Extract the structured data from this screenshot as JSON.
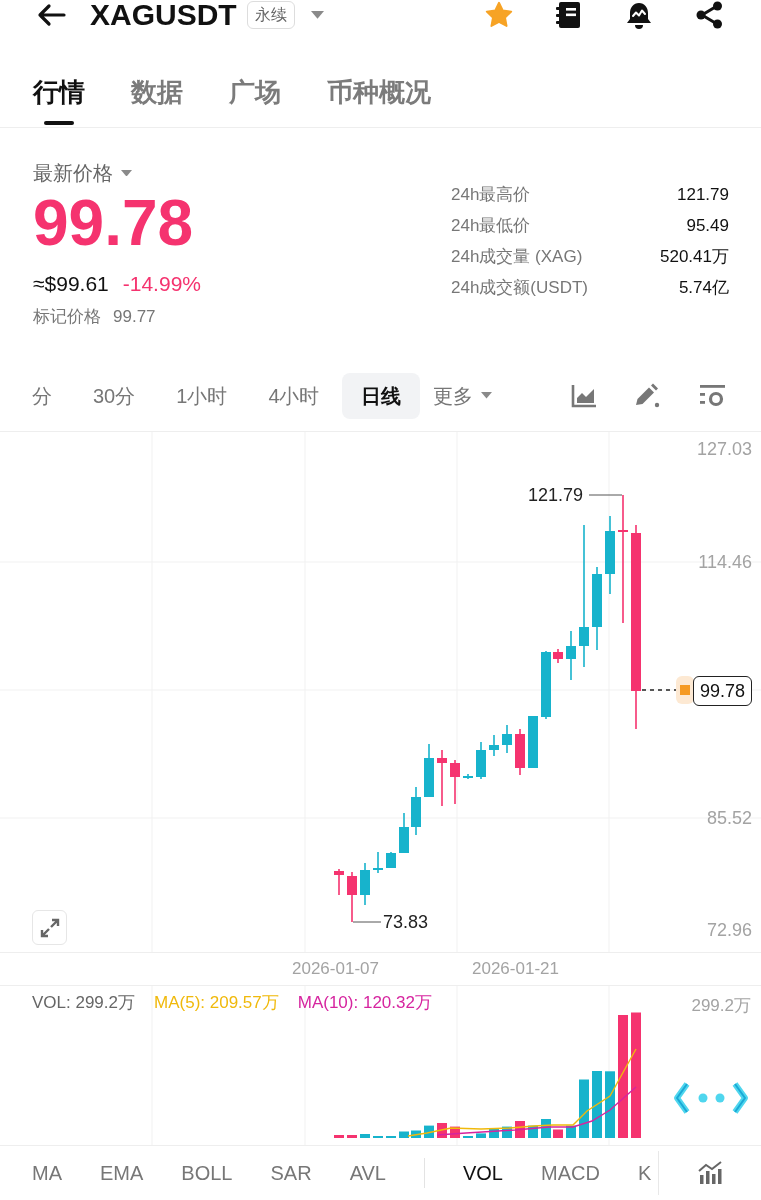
{
  "header": {
    "title": "XAGUSDT",
    "badge": "永续",
    "favorite": true
  },
  "tabs": [
    {
      "label": "行情",
      "selected": true
    },
    {
      "label": "数据",
      "selected": false
    },
    {
      "label": "广场",
      "selected": false
    },
    {
      "label": "币种概况",
      "selected": false
    }
  ],
  "price": {
    "label": "最新价格",
    "last": "99.78",
    "falling": true,
    "approx": "≈$99.61",
    "change": "-14.99%",
    "mark_label": "标记价格",
    "mark_value": "99.77"
  },
  "stats": [
    {
      "label": "24h最高价",
      "value": "121.79"
    },
    {
      "label": "24h最低价",
      "value": "95.49"
    },
    {
      "label": "24h成交量 (XAG)",
      "value": "520.41万"
    },
    {
      "label": "24h成交额(USDT)",
      "value": "5.74亿"
    }
  ],
  "intervals": [
    {
      "label": "分",
      "selected": false
    },
    {
      "label": "30分",
      "selected": false
    },
    {
      "label": "1小时",
      "selected": false
    },
    {
      "label": "4小时",
      "selected": false
    },
    {
      "label": "日线",
      "selected": true
    }
  ],
  "more": "更多",
  "chart": {
    "price_axis": [
      "127.03",
      "114.46",
      "85.52",
      "72.96"
    ],
    "high_marker": "121.79",
    "low_marker": "73.83",
    "last_price": "99.78",
    "date_axis": [
      "2026-01-07",
      "2026-01-21"
    ]
  },
  "volume": {
    "legend": [
      {
        "text": "VOL: 299.2万",
        "color": "#666666"
      },
      {
        "text": "MA(5): 209.57万",
        "color": "#f0b90b"
      },
      {
        "text": "MA(10): 120.32万",
        "color": "#d6249f"
      }
    ],
    "axis_max": "299.2万"
  },
  "main_indicators": [
    {
      "label": "MA",
      "selected": false
    },
    {
      "label": "EMA",
      "selected": false
    },
    {
      "label": "BOLL",
      "selected": false
    },
    {
      "label": "SAR",
      "selected": false
    },
    {
      "label": "AVL",
      "selected": false
    }
  ],
  "sub_indicators": [
    {
      "label": "VOL",
      "selected": true
    },
    {
      "label": "MACD",
      "selected": false
    },
    {
      "label": "K",
      "selected": false
    }
  ]
}
